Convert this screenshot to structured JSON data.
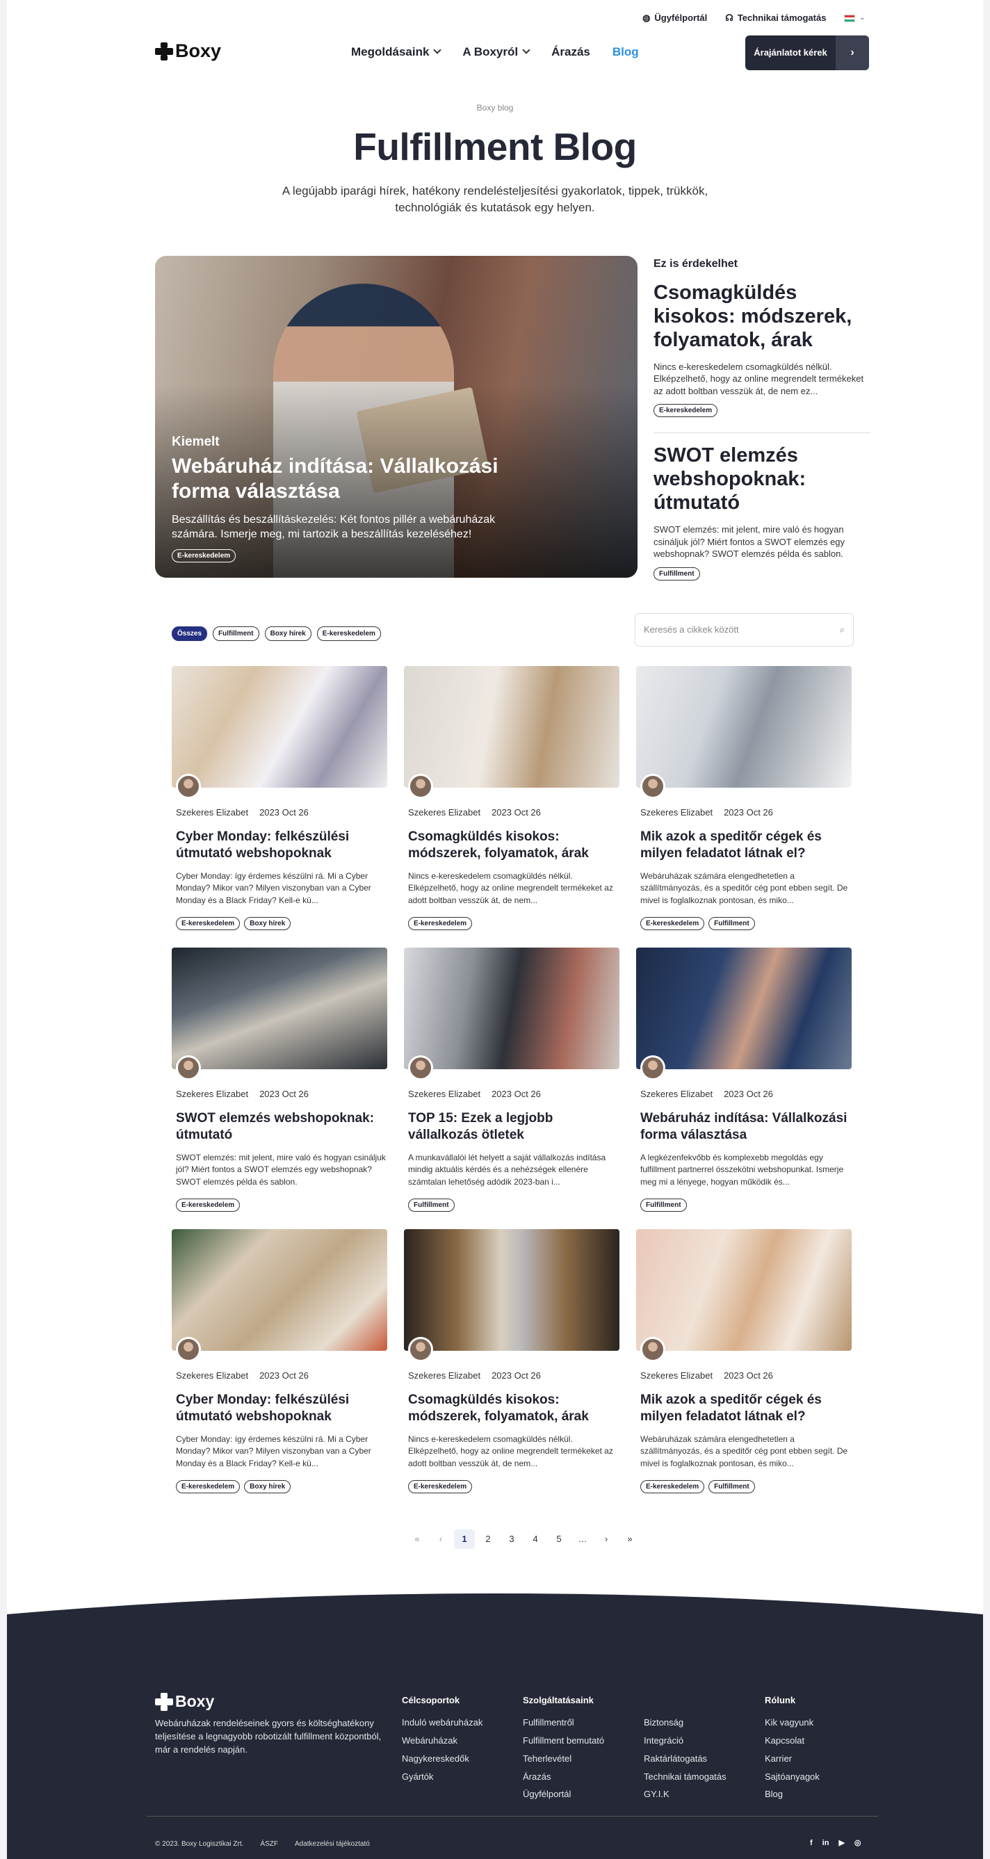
{
  "topbar": {
    "portal": "Ügyfélportál",
    "support": "Technikai támogatás"
  },
  "nav": {
    "logo": "Boxy",
    "items": [
      {
        "label": "Megoldásaink"
      },
      {
        "label": "A Boxyról"
      },
      {
        "label": "Árazás"
      },
      {
        "label": "Blog"
      }
    ],
    "cta": "Árajánlatot kérek"
  },
  "hero": {
    "eyebrow": "Boxy blog",
    "title": "Fulfillment Blog",
    "intro": "A legújabb iparági hírek, hatékony rendelésteljesítési gyakorlatok, tippek, trükkök, technológiák és kutatások egy helyen."
  },
  "featured": {
    "badge": "Kiemelt",
    "title": "Webáruház indítása: Vállalkozási forma választása",
    "excerpt": "Beszállítás és beszállításkezelés: Két fontos pillér a webáruházak számára. Ismerje meg, mi tartozik a beszállítás kezeléséhez!",
    "tag": "E-kereskedelem"
  },
  "side": {
    "label": "Ez is érdekelhet",
    "items": [
      {
        "title": "Csomagküldés kisokos: módszerek, folyamatok, árak",
        "excerpt": "Nincs e-kereskedelem csomagküldés nélkül. Elképzelhető, hogy az online megrendelt termékeket az adott boltban vesszük át, de nem ez...",
        "tag": "E-kereskedelem"
      },
      {
        "title": "SWOT elemzés webshopoknak: útmutató",
        "excerpt": "SWOT elemzés: mit jelent, mire való és hogyan csináljuk jól? Miért fontos a SWOT elemzés egy webshopnak? SWOT elemzés példa és sablon.",
        "tag": "Fulfillment"
      }
    ]
  },
  "filters": [
    "Összes",
    "Fulfillment",
    "Boxy hírek",
    "E-kereskedelem"
  ],
  "search": {
    "placeholder": "Keresés a cikkek között"
  },
  "cards": [
    {
      "author": "Szekeres Elizabet",
      "date": "2023 Oct 26",
      "title": "Cyber Monday: felkészülési útmutató webshopoknak",
      "excerpt": "Cyber Monday: így érdemes készülni rá. Mi a Cyber Monday? Mikor van? Milyen viszonyban van a Cyber Monday és a Black Friday? Kell-e kü...",
      "tags": [
        "E-kereskedelem",
        "Boxy hírek"
      ]
    },
    {
      "author": "Szekeres Elizabet",
      "date": "2023 Oct 26",
      "title": "Csomagküldés kisokos: módszerek, folyamatok, árak",
      "excerpt": "Nincs e-kereskedelem csomagküldés nélkül. Elképzelhető, hogy az online megrendelt termékeket az adott boltban vesszük át, de nem...",
      "tags": [
        "E-kereskedelem"
      ]
    },
    {
      "author": "Szekeres Elizabet",
      "date": "2023 Oct 26",
      "title": "Mik azok a speditőr cégek és milyen feladatot látnak el?",
      "excerpt": "Webáruházak számára elengedhetetlen a szállítmányozás, és a speditőr cég pont ebben segít. De mivel is foglalkoznak pontosan, és miko...",
      "tags": [
        "E-kereskedelem",
        "Fulfillment"
      ]
    },
    {
      "author": "Szekeres Elizabet",
      "date": "2023 Oct 26",
      "title": "SWOT elemzés webshopoknak: útmutató",
      "excerpt": "SWOT elemzés: mit jelent, mire való és hogyan csináljuk jól? Miért fontos a SWOT elemzés egy webshopnak? SWOT elemzés példa és sablon.",
      "tags": [
        "E-kereskedelem"
      ]
    },
    {
      "author": "Szekeres Elizabet",
      "date": "2023 Oct 26",
      "title": "TOP 15: Ezek a legjobb vállalkozás ötletek",
      "excerpt": "A munkavállalói lét helyett a saját vállalkozás indítása mindig aktuális kérdés és a nehézségek ellenére számtalan lehetőség adódik 2023-ban i...",
      "tags": [
        "Fulfillment"
      ]
    },
    {
      "author": "Szekeres Elizabet",
      "date": "2023 Oct 26",
      "title": "Webáruház indítása: Vállalkozási forma választása",
      "excerpt": "A legkézenfekvőbb és komplexebb megoldás egy fulfillment partnerrel összekötni webshopunkat. Ismerje meg mi a lényege, hogyan működik és...",
      "tags": [
        "Fulfillment"
      ]
    },
    {
      "author": "Szekeres Elizabet",
      "date": "2023 Oct 26",
      "title": "Cyber Monday: felkészülési útmutató webshopoknak",
      "excerpt": "Cyber Monday: így érdemes készülni rá. Mi a Cyber Monday? Mikor van? Milyen viszonyban van a Cyber Monday és a Black Friday? Kell-e kü...",
      "tags": [
        "E-kereskedelem",
        "Boxy hírek"
      ]
    },
    {
      "author": "Szekeres Elizabet",
      "date": "2023 Oct 26",
      "title": "Csomagküldés kisokos: módszerek, folyamatok, árak",
      "excerpt": "Nincs e-kereskedelem csomagküldés nélkül. Elképzelhető, hogy az online megrendelt termékeket az adott boltban vesszük át, de nem...",
      "tags": [
        "E-kereskedelem"
      ]
    },
    {
      "author": "Szekeres Elizabet",
      "date": "2023 Oct 26",
      "title": "Mik azok a speditőr cégek és milyen feladatot látnak el?",
      "excerpt": "Webáruházak számára elengedhetetlen a szállítmányozás, és a speditőr cég pont ebben segít. De mivel is foglalkoznak pontosan, és miko...",
      "tags": [
        "E-kereskedelem",
        "Fulfillment"
      ]
    }
  ],
  "pagination": {
    "pages": [
      "1",
      "2",
      "3",
      "4",
      "5",
      "…"
    ],
    "current": "1"
  },
  "footer": {
    "logo": "Boxy",
    "desc": "Webáruházak rendeléseinek gyors és költséghatékony teljesítése a legnagyobb robotizált fulfillment központból, már a rendelés napján.",
    "cols": [
      {
        "title": "Célcsoportok",
        "items": [
          "Induló webáruházak",
          "Webáruházak",
          "Nagykereskedők",
          "Gyártók"
        ]
      },
      {
        "title": "Szolgáltatásaink",
        "items": [
          "Fulfillmentről",
          "Fulfillment bemutató",
          "Teherlevétel",
          "Árazás",
          "Ügyfélportál"
        ]
      },
      {
        "title": "",
        "items": [
          "Biztonság",
          "Integráció",
          "Raktárlátogatás",
          "Technikai támogatás",
          "GY.I.K"
        ]
      },
      {
        "title": "Rólunk",
        "items": [
          "Kik vagyunk",
          "Kapcsolat",
          "Karrier",
          "Sajtóanyagok",
          "Blog"
        ]
      }
    ],
    "copyright": "© 2023. Boxy Logisztikai Zrt.",
    "aszf": "ÁSZF",
    "privacy": "Adatkezelési tájékoztató"
  }
}
